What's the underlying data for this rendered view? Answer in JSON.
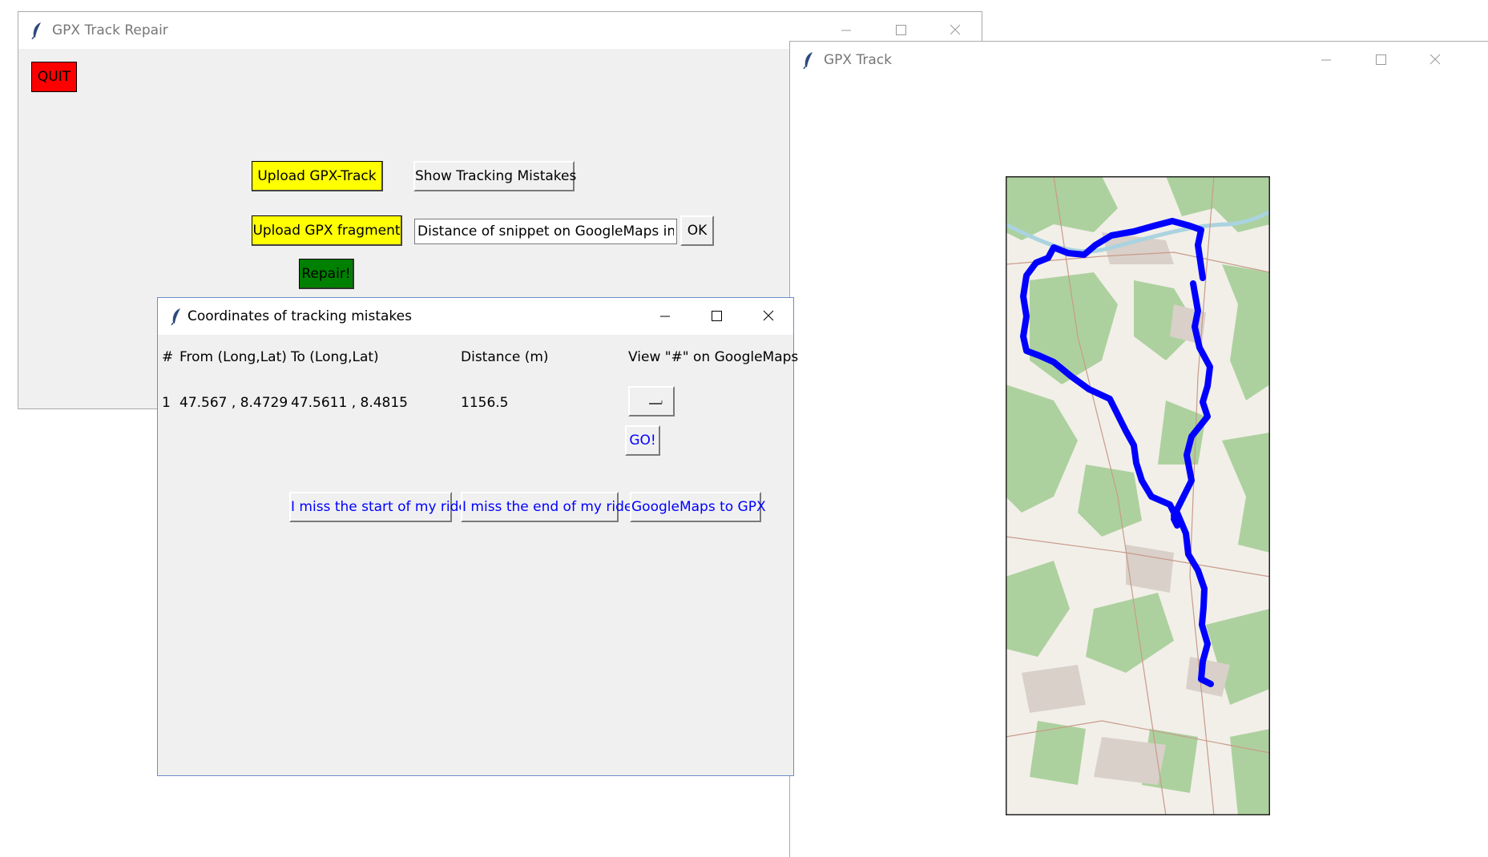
{
  "main_window": {
    "title": "GPX Track Repair",
    "quit_label": "QUIT",
    "upload_track_label": "Upload GPX-Track",
    "show_mistakes_label": "Show Tracking Mistakes",
    "upload_fragment_label": "Upload GPX fragment",
    "distance_input_value": "Distance of snippet on GoogleMaps in m",
    "ok_label": "OK",
    "repair_label": "Repair!"
  },
  "mistakes_window": {
    "title": "Coordinates of tracking mistakes",
    "headers": {
      "num": "#",
      "from": "From (Long,Lat)",
      "to": "To (Long,Lat)",
      "distance": "Distance (m)",
      "view": "View \"#\" on GoogleMaps"
    },
    "rows": [
      {
        "num": "1",
        "from": "47.567 , 8.4729",
        "to": "47.5611 , 8.4815",
        "distance": "1156.5"
      }
    ],
    "go_label": "GO!",
    "miss_start_label": "I miss the start of my ride",
    "miss_end_label": "I miss the end of my ride",
    "maps_to_gpx_label": "GoogleMaps to GPX"
  },
  "track_window": {
    "title": "GPX Track"
  },
  "colors": {
    "quit": "#ff0000",
    "upload": "#ffff00",
    "repair": "#008000",
    "link_text": "#0000ff",
    "track_line": "#0000ff"
  }
}
